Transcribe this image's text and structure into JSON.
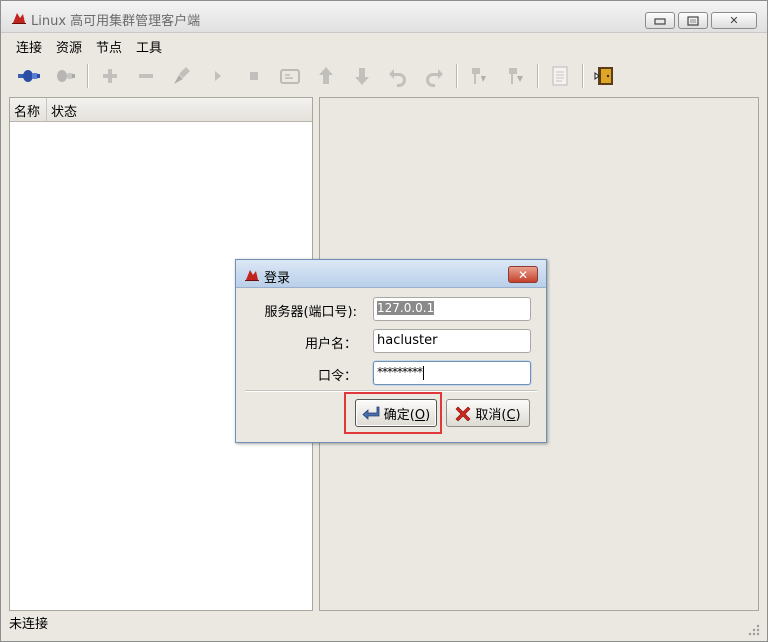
{
  "window": {
    "title": "Linux 高可用集群管理客户端",
    "controls": {
      "minimize": "▭",
      "maximize": "▢",
      "close": "✕"
    }
  },
  "menubar": {
    "items": [
      "连接",
      "资源",
      "节点",
      "工具"
    ]
  },
  "toolbar": {
    "icons": [
      "connect-icon",
      "disconnect-icon",
      "add-icon",
      "remove-icon",
      "cleanup-icon",
      "start-icon",
      "stop-icon",
      "default-icon",
      "up-icon",
      "down-icon",
      "undo-icon",
      "redo-icon",
      "migrate-icon",
      "unmigrate-icon",
      "document-icon",
      "exit-icon"
    ]
  },
  "tree": {
    "columns": [
      "名称",
      "状态"
    ]
  },
  "statusbar": {
    "text": "未连接"
  },
  "dialog": {
    "title": "登录",
    "close_label": "✕",
    "fields": {
      "server_label": "服务器(端口号):",
      "server_value": "127.0.0.1",
      "user_label": "用户名：",
      "user_value": "hacluster",
      "password_label": "口令：",
      "password_value": "*********"
    },
    "ok_button": {
      "text": "确定(",
      "mnemonic": "O",
      "suffix": ")"
    },
    "cancel_button": {
      "text": "取消(",
      "mnemonic": "C",
      "suffix": ")"
    }
  },
  "colors": {
    "highlight": "#e0383a",
    "window_bg": "#ebe8e2",
    "dialog_title_bg": "#b9cfe9"
  }
}
